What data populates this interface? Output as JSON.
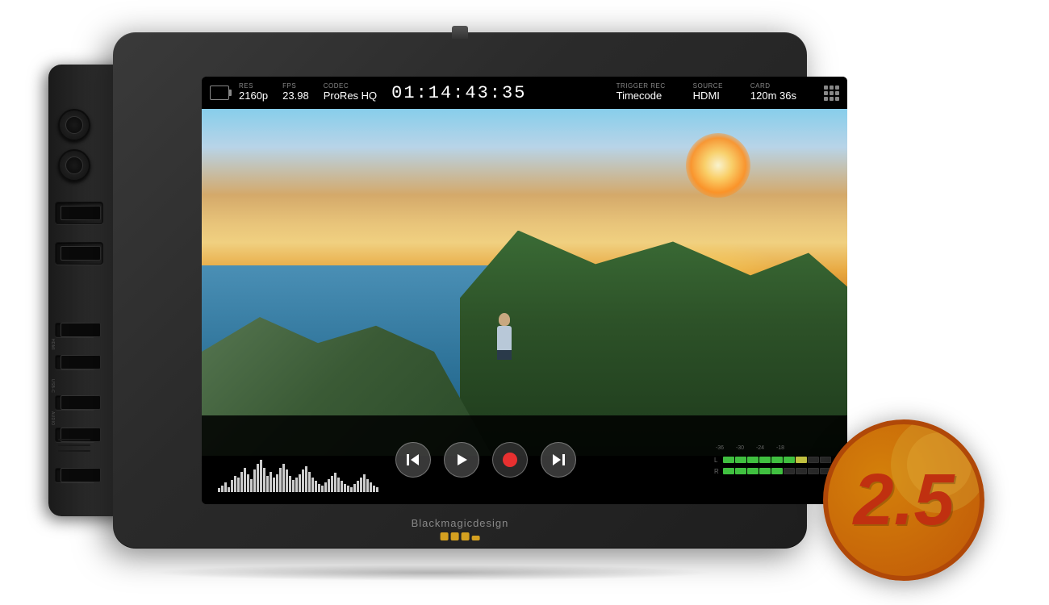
{
  "device": {
    "brand": "Blackmagicdesign",
    "brand_dots_label": "brand dots"
  },
  "hud": {
    "icon_label": "monitor icon",
    "res_label": "RES",
    "res_value": "2160p",
    "fps_label": "FPS",
    "fps_value": "23.98",
    "codec_label": "CODEC",
    "codec_value": "ProRes HQ",
    "timecode": "01:14:43:35",
    "trigger_label": "TRIGGER REC",
    "trigger_value": "Timecode",
    "source_label": "SOURCE",
    "source_value": "HDMI",
    "card_label": "CARD",
    "card_value": "120m 36s",
    "grid_icon": "grid-icon"
  },
  "transport": {
    "rewind_label": "skip to start",
    "play_label": "play",
    "record_label": "record",
    "forward_label": "skip forward"
  },
  "audio": {
    "scale_labels": [
      "-36",
      "-30",
      "-24",
      "-18"
    ],
    "channel_left": "L",
    "channel_right": "R"
  },
  "version_badge": {
    "number": "2.5"
  }
}
